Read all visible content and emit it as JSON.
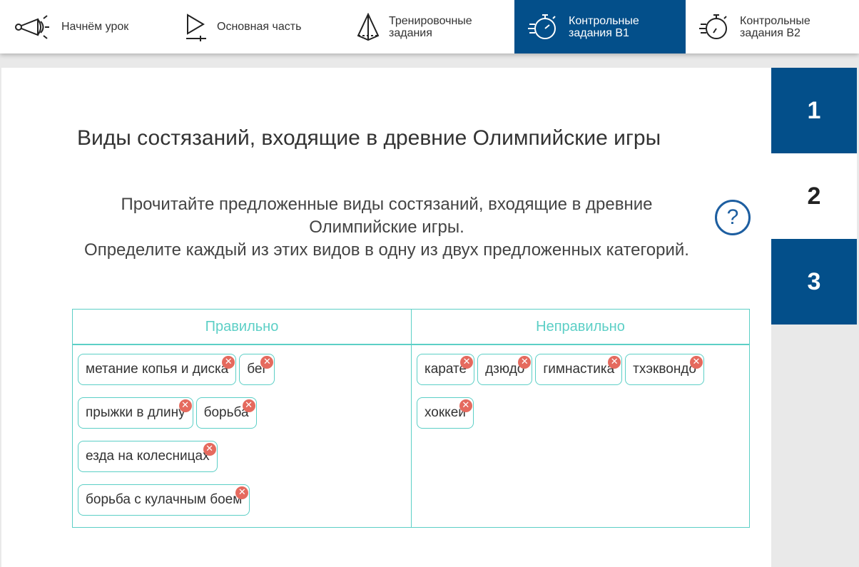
{
  "nav": [
    {
      "label": "Начнём урок",
      "icon": "megaphone-icon"
    },
    {
      "label": "Основная часть",
      "icon": "play-icon"
    },
    {
      "label": "Тренировочные\nзадания",
      "icon": "pyramid-icon"
    },
    {
      "label": "Контрольные\nзадания В1",
      "icon": "stopwatch-icon"
    },
    {
      "label": "Контрольные\nзадания В2",
      "icon": "stopwatch-icon"
    }
  ],
  "task": {
    "title": "Виды состязаний, входящие в древние Олимпийские игры",
    "instruction_1": "Прочитайте предложенные виды состязаний, входящие в древние Олимпийские игры.",
    "instruction_2": "Определите каждый из этих видов в одну из двух предложенных категорий.",
    "help_symbol": "?"
  },
  "columns": {
    "correct": {
      "header": "Правильно",
      "items": [
        "метание копья и диска",
        "бег",
        "прыжки в длину",
        "борьба",
        "езда на колесницах",
        "борьба с кулачным боем"
      ]
    },
    "incorrect": {
      "header": "Неправильно",
      "items": [
        "карате",
        "дзюдо",
        "гимнастика",
        "тхэквондо",
        "хоккей"
      ]
    }
  },
  "side_nav": [
    "1",
    "2",
    "3"
  ],
  "colors": {
    "primary": "#034f8a",
    "accent": "#5ccfc6",
    "remove": "#e56a5e"
  }
}
